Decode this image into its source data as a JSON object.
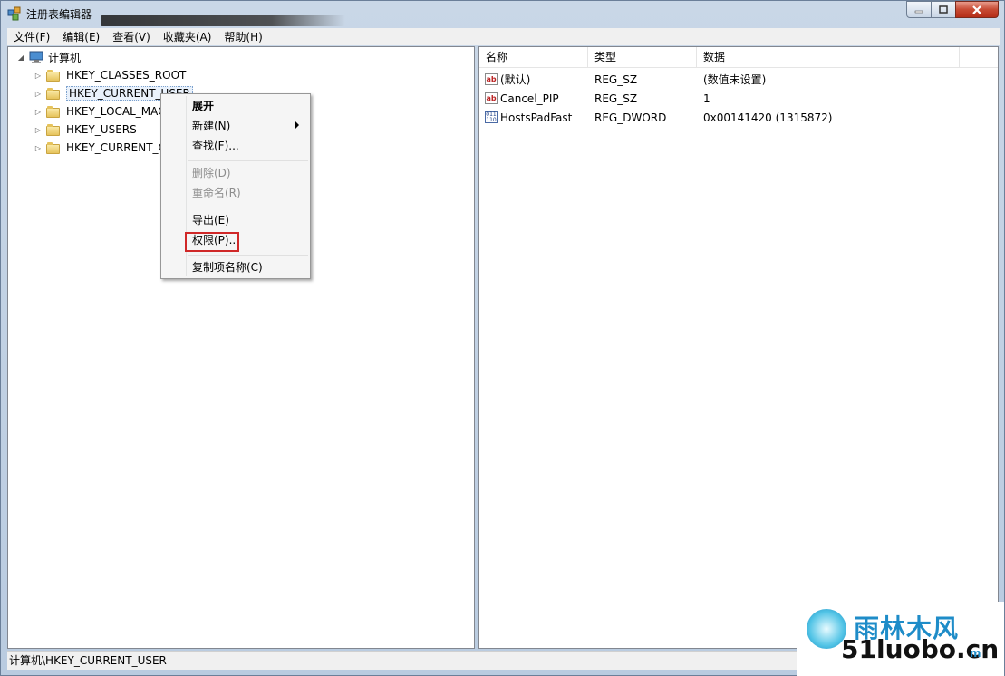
{
  "window": {
    "title": "注册表编辑器"
  },
  "menubar": {
    "items": [
      "文件(F)",
      "编辑(E)",
      "查看(V)",
      "收藏夹(A)",
      "帮助(H)"
    ]
  },
  "tree": {
    "root": "计算机",
    "items": [
      "HKEY_CLASSES_ROOT",
      "HKEY_CURRENT_USER",
      "HKEY_LOCAL_MAC",
      "HKEY_USERS",
      "HKEY_CURRENT_C"
    ]
  },
  "values_pane": {
    "headers": {
      "name": "名称",
      "type": "类型",
      "data": "数据"
    },
    "rows": [
      {
        "name": "(默认)",
        "type": "REG_SZ",
        "data": "(数值未设置)",
        "icon": "string-value-icon"
      },
      {
        "name": "Cancel_PIP",
        "type": "REG_SZ",
        "data": "1",
        "icon": "string-value-icon"
      },
      {
        "name": "HostsPadFast",
        "type": "REG_DWORD",
        "data": "0x00141420 (1315872)",
        "icon": "binary-value-icon"
      }
    ]
  },
  "context_menu": {
    "expand": "展开",
    "new": "新建(N)",
    "find": "查找(F)...",
    "delete": "删除(D)",
    "rename": "重命名(R)",
    "export": "导出(E)",
    "permissions": "权限(P)...",
    "copy_key_name": "复制项名称(C)"
  },
  "status": {
    "path": "计算机\\HKEY_CURRENT_USER"
  },
  "watermark": {
    "cn": "雨林木风",
    "url": "51luobo.cn",
    "url_small": "m"
  },
  "colors": {
    "highlight_border": "#d02828",
    "close_button": "#c74a33"
  }
}
